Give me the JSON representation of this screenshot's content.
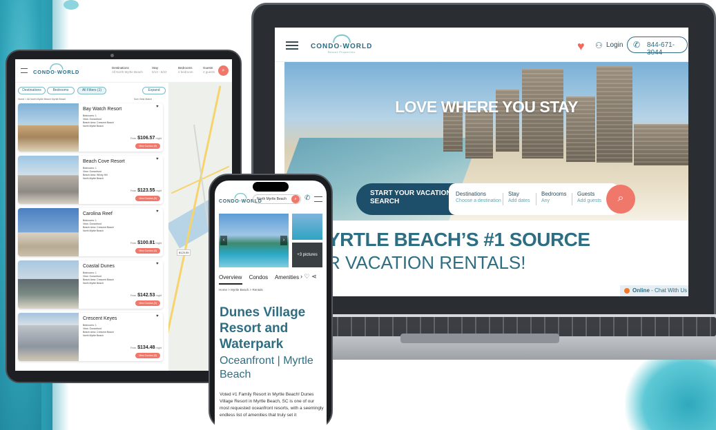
{
  "brand": {
    "logo_text": "CONDO·WORLD",
    "logo_sub": "Resort Properties"
  },
  "colors": {
    "teal": "#2d6e82",
    "navy": "#1d4f6b",
    "coral": "#f0786a"
  },
  "laptop": {
    "header": {
      "login": "Login",
      "phone": "844-671-3044"
    },
    "hero": {
      "tagline": "LOVE WHERE YOU STAY",
      "search": {
        "start": "START YOUR VACATION SEARCH",
        "destinations_label": "Destinations",
        "destinations_hint": "Choose a destination",
        "stay_label": "Stay",
        "stay_hint": "Add dates",
        "bedrooms_label": "Bedrooms",
        "bedrooms_hint": "Any",
        "guests_label": "Guests",
        "guests_hint": "Add guests"
      }
    },
    "headline_1": "YRTLE BEACH’S #1 SOURCE",
    "headline_2": "R VACATION RENTALS!",
    "chat": {
      "status": "Online",
      "label": " - Chat With Us"
    }
  },
  "tablet": {
    "header": {
      "dest_label": "Destinations",
      "dest_value": "All North Myrtle Beach",
      "stay_label": "Stay",
      "stay_value": "5/13 - 5/22",
      "bed_label": "Bedrooms",
      "bed_value": "2 bedroom",
      "guest_label": "Guests",
      "guest_value": "4 guests"
    },
    "filters": {
      "destinations": "Destinations",
      "bedrooms": "Bedrooms",
      "all_filters": "All Filters (1)",
      "expand": "Expand"
    },
    "breadcrumb": "Home  >  All North Myrtle Beach Myrtle Beach",
    "sort": "Sort: Best Match",
    "map_price": "$123.55",
    "from_label": "From",
    "night_label": "/ night",
    "listings": [
      {
        "name": "Bay Watch Resort",
        "bedrooms": "Bedrooms: 1",
        "view": "View: Oceanfront",
        "area": "Beach Area: Crescent Beach",
        "location": "North Myrtle Beach",
        "price": "$106.57",
        "button": "View Condos (9)"
      },
      {
        "name": "Beach Cove Resort",
        "bedrooms": "Bedrooms: 1",
        "view": "View: Oceanfront",
        "area": "Beach Area: Windy Hill",
        "location": "North Myrtle Beach",
        "price": "$123.55",
        "button": "View Condos (9)"
      },
      {
        "name": "Carolina Reef",
        "bedrooms": "Bedrooms: 1",
        "view": "View: Oceanfront",
        "area": "Beach Area: Crescent Beach",
        "location": "North Myrtle Beach",
        "price": "$100.81",
        "button": "View Condos (9)"
      },
      {
        "name": "Coastal Dunes",
        "bedrooms": "Bedrooms: 1",
        "view": "View: Oceanfront",
        "area": "Beach Area: Crescent Beach",
        "location": "North Myrtle Beach",
        "price": "$142.53",
        "button": "View Condos (9)"
      },
      {
        "name": "Crescent Keyes",
        "bedrooms": "Bedrooms: 1",
        "view": "View: Oceanfront",
        "area": "Beach Area: Crescent Beach",
        "location": "North Myrtle Beach",
        "price": "$134.48",
        "button": "View Condos (9)"
      }
    ]
  },
  "phone": {
    "search_value": "North Myrtle Beach",
    "pictures_label": "+3 pictures",
    "tabs": [
      "Overview",
      "Condos",
      "Amenities"
    ],
    "breadcrumb": "Home  >  Myrtle Beach  >  Rentals",
    "title": "Dunes Village Resort and Waterpark",
    "subtitle": "Oceanfront | Myrtle Beach",
    "description": "Voted #1 Family Resort in Myrtle Beach! Dunes Village Resort in Myrtle Beach, SC is one of our most requested oceanfront resorts, with a seemingly endless list of amenities that truly set it"
  }
}
